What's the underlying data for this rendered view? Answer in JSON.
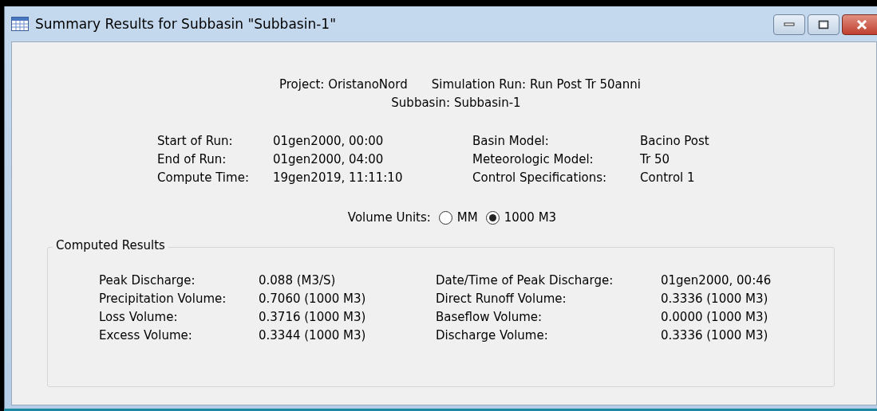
{
  "window": {
    "title": "Summary Results for Subbasin \"Subbasin-1\""
  },
  "header": {
    "project": "Project: OristanoNord",
    "simulation_run": "Simulation Run: Run Post Tr 50anni",
    "subbasin": "Subbasin: Subbasin-1"
  },
  "run_info": {
    "left": [
      {
        "label": "Start of Run:",
        "value": "01gen2000, 00:00"
      },
      {
        "label": "End of Run:",
        "value": "01gen2000, 04:00"
      },
      {
        "label": "Compute Time:",
        "value": "19gen2019, 11:11:10"
      }
    ],
    "right": [
      {
        "label": "Basin Model:",
        "value": "Bacino Post"
      },
      {
        "label": "Meteorologic Model:",
        "value": "Tr 50"
      },
      {
        "label": "Control Specifications:",
        "value": "Control 1"
      }
    ]
  },
  "volume_units": {
    "label": "Volume Units:",
    "options": [
      {
        "label": "MM",
        "selected": false
      },
      {
        "label": "1000 M3",
        "selected": true
      }
    ]
  },
  "computed_results": {
    "title": "Computed Results",
    "left": [
      {
        "label": "Peak Discharge:",
        "value": "0.088 (M3/S)"
      },
      {
        "label": "Precipitation Volume:",
        "value": "0.7060 (1000 M3)"
      },
      {
        "label": "Loss Volume:",
        "value": "0.3716 (1000 M3)"
      },
      {
        "label": "Excess Volume:",
        "value": "0.3344 (1000 M3)"
      }
    ],
    "right": [
      {
        "label": "Date/Time of Peak Discharge:",
        "value": "01gen2000, 00:46"
      },
      {
        "label": "Direct Runoff Volume:",
        "value": "0.3336 (1000 M3)"
      },
      {
        "label": "Baseflow Volume:",
        "value": "0.0000 (1000 M3)"
      },
      {
        "label": "Discharge Volume:",
        "value": "0.3336 (1000 M3)"
      }
    ]
  }
}
